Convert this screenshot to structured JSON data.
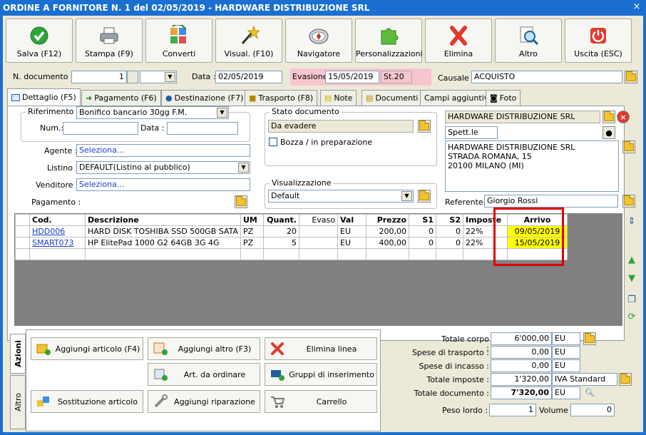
{
  "window": {
    "title": "ORDINE A FORNITORE N. 1 del 02/05/2019 - HARDWARE DISTRIBUZIONE SRL",
    "close": "×"
  },
  "toolbar": [
    {
      "id": "salva",
      "label": "Salva (F12)",
      "icon": "check-icon"
    },
    {
      "id": "stampa",
      "label": "Stampa (F9)",
      "icon": "printer-icon"
    },
    {
      "id": "converti",
      "label": "Converti",
      "icon": "convert-icon"
    },
    {
      "id": "visual",
      "label": "Visual. (F10)",
      "icon": "magic-wand-icon"
    },
    {
      "id": "navigatore",
      "label": "Navigatore",
      "icon": "compass-icon"
    },
    {
      "id": "personalizzazioni",
      "label": "Personalizzazioni",
      "icon": "puzzle-icon"
    },
    {
      "id": "elimina",
      "label": "Elimina",
      "icon": "delete-x-icon"
    },
    {
      "id": "altro",
      "label": "Altro",
      "icon": "magnifier-icon"
    },
    {
      "id": "uscita",
      "label": "Uscita (ESC)",
      "icon": "power-icon"
    }
  ],
  "header": {
    "ndoc_label": "N. documento :",
    "ndoc_value": "1",
    "data_label": "Data :",
    "data_value": "02/05/2019",
    "evasione_label": "Evasione:",
    "evasione_value": "15/05/2019",
    "stato_value": "St.20",
    "causale_label": "Causale :",
    "causale_value": "ACQUISTO"
  },
  "tabs": [
    {
      "label": "Dettaglio (F5)",
      "icon": "detail-icon"
    },
    {
      "label": "Pagamento (F6)",
      "icon": "payment-icon"
    },
    {
      "label": "Destinazione (F7)",
      "icon": "destination-icon"
    },
    {
      "label": "Trasporto (F8)",
      "icon": "truck-icon"
    },
    {
      "label": "Note",
      "icon": "note-icon"
    },
    {
      "label": "Documenti",
      "icon": "documents-icon"
    },
    {
      "label": "Campi aggiuntivi",
      "icon": ""
    },
    {
      "label": "Foto",
      "icon": "camera-icon"
    }
  ],
  "riferimento": {
    "title": "Riferimento documento cliente/fornitore",
    "num_label": "Num.:",
    "num_value": "",
    "data_label": "Data :",
    "data_value": ""
  },
  "fields": {
    "agente_label": "Agente :",
    "agente_value": "Seleziona...",
    "listino_label": "Listino :",
    "listino_value": "DEFAULT(Listino al pubblico)",
    "venditore_label": "Venditore :",
    "venditore_value": "Seleziona...",
    "pagamento_label": "Pagamento :",
    "pagamento_value": "Bonifico bancario 30gg F.M."
  },
  "stato": {
    "title": "Stato documento",
    "value": "Da evadere",
    "bozza_label": "Bozza / in preparazione"
  },
  "visualizzazione": {
    "title": "Visualizzazione",
    "value": "Default"
  },
  "fornitore": {
    "name": "HARDWARE DISTRIBUZIONE SRL",
    "title": "Spett.le",
    "address1": "HARDWARE DISTRIBUZIONE SRL",
    "address2": "STRADA ROMANA, 15",
    "address3": "20100 MILANO (MI)",
    "referente_label": "Referente",
    "referente_value": "Giorgio Rossi"
  },
  "grid": {
    "columns": [
      "Cod.",
      "Descrizione",
      "UM",
      "Quant.",
      "Evaso",
      "Val",
      "Prezzo",
      "S1",
      "S2",
      "Imposte",
      "Arrivo"
    ],
    "rows": [
      {
        "cod": "HDD006",
        "descrizione": "HARD DISK TOSHIBA SSD 500GB SATA",
        "um": "PZ",
        "quant": "20",
        "evaso": "",
        "val": "EU",
        "prezzo": "200,00",
        "s1": "0",
        "s2": "0",
        "imposte": "22%",
        "arrivo": "09/05/2019"
      },
      {
        "cod": "SMART073",
        "descrizione": "HP ElitePad 1000 G2 64GB 3G 4G",
        "um": "PZ",
        "quant": "5",
        "evaso": "",
        "val": "EU",
        "prezzo": "400,00",
        "s1": "0",
        "s2": "0",
        "imposte": "22%",
        "arrivo": "15/05/2019"
      }
    ]
  },
  "actions": {
    "vtab_azioni": "Azioni",
    "vtab_altro": "Altro",
    "aggiungi_articolo": "Aggiungi articolo (F4)",
    "aggiungi_altro": "Aggiungi altro (F3)",
    "elimina_linea": "Elimina linea",
    "art_da_ordinare": "Art. da ordinare",
    "gruppi": "Gruppi di inserimento",
    "sostituzione": "Sostituzione articolo",
    "riparazione": "Aggiungi riparazione",
    "carrello": "Carrello"
  },
  "totals": {
    "corpo_label": "Totale corpo :",
    "corpo_value": "6'000,00",
    "corpo_cur": "EU",
    "trasporto_label": "Spese di trasporto :",
    "trasporto_value": "0,00",
    "trasporto_cur": "EU",
    "incasso_label": "Spese di incasso :",
    "incasso_value": "0,00",
    "incasso_cur": "EU",
    "imposte_label": "Totale imposte :",
    "imposte_value": "1'320,00",
    "imposte_iva": "IVA Standard",
    "documento_label": "Totale documento :",
    "documento_value": "7'320,00",
    "documento_cur": "EU",
    "peso_label": "Peso lordo :",
    "peso_value": "1",
    "volume_label": "Volume :",
    "volume_value": "0"
  },
  "colors": {
    "title_bar": "#1a6fd0",
    "window_bg": "#ece9d8",
    "highlight": "#ffff00",
    "annotation": "#e00000",
    "evasione_bg": "#f7c6cc"
  }
}
